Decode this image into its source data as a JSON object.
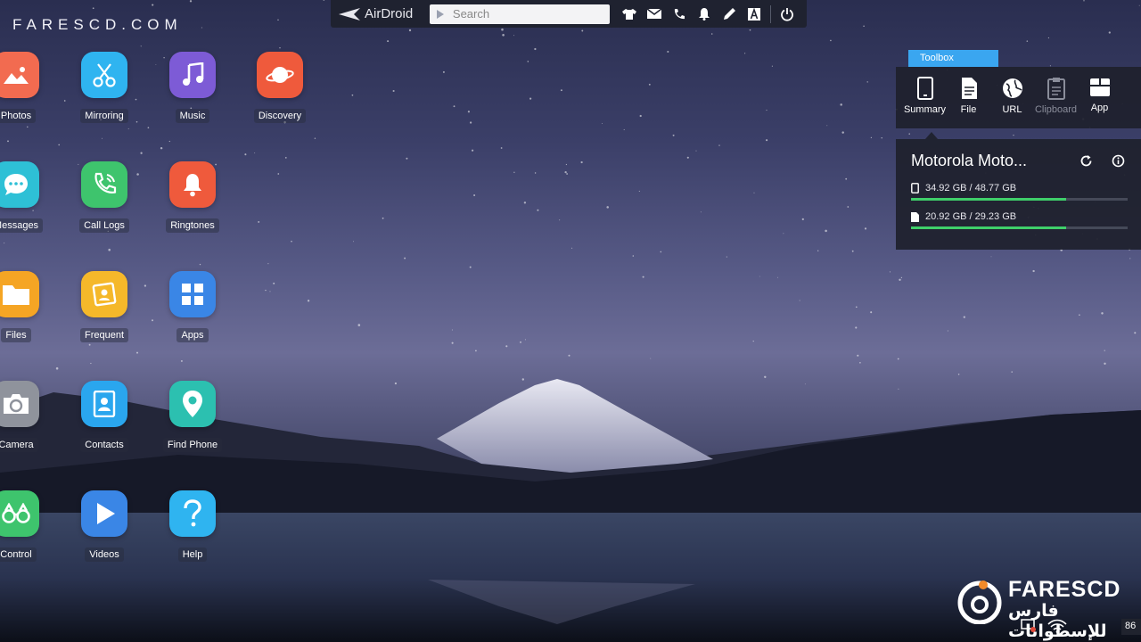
{
  "watermark_top": "FARESCD.COM",
  "topbar": {
    "brand": "AirDroid",
    "search_placeholder": "Search",
    "icons": [
      "tshirt-icon",
      "mail-icon",
      "phone-icon",
      "bell-icon",
      "pen-icon",
      "font-icon",
      "power-icon"
    ]
  },
  "apps": [
    {
      "label": "Photos",
      "color": "#f26b50",
      "icon": "photos-icon"
    },
    {
      "label": "Mirroring",
      "color": "#2fb4f0",
      "icon": "scissors-icon"
    },
    {
      "label": "Music",
      "color": "#7d5bd6",
      "icon": "music-note-icon"
    },
    {
      "label": "Discovery",
      "color": "#ef5a3c",
      "icon": "planet-icon"
    },
    {
      "label": "Messages",
      "color": "#2ec0d6",
      "icon": "chat-bubble-icon"
    },
    {
      "label": "Call Logs",
      "color": "#3ec46d",
      "icon": "phone-icon"
    },
    {
      "label": "Ringtones",
      "color": "#ef5a3c",
      "icon": "bell-icon"
    },
    {
      "label": "Files",
      "color": "#f5a524",
      "icon": "folder-icon"
    },
    {
      "label": "Frequent",
      "color": "#f5b82a",
      "icon": "contact-card-icon"
    },
    {
      "label": "Apps",
      "color": "#3a86e6",
      "icon": "grid-icon"
    },
    {
      "label": "Camera",
      "color": "#8f939c",
      "icon": "camera-icon"
    },
    {
      "label": "Contacts",
      "color": "#2aa6ee",
      "icon": "address-book-icon"
    },
    {
      "label": "Find Phone",
      "color": "#2cc0b0",
      "icon": "location-pin-icon"
    },
    {
      "label": "Control",
      "color": "#3ec46d",
      "icon": "binoculars-icon"
    },
    {
      "label": "Videos",
      "color": "#3a86e6",
      "icon": "play-icon"
    },
    {
      "label": "Help",
      "color": "#2fb4f0",
      "icon": "question-icon"
    }
  ],
  "toolbox": {
    "tab_label": "Toolbox",
    "tools": [
      {
        "label": "Summary",
        "icon": "phone-outline-icon",
        "disabled": false
      },
      {
        "label": "File",
        "icon": "document-icon",
        "disabled": false
      },
      {
        "label": "URL",
        "icon": "globe-icon",
        "disabled": false
      },
      {
        "label": "Clipboard",
        "icon": "clipboard-icon",
        "disabled": true
      },
      {
        "label": "App",
        "icon": "app-box-icon",
        "disabled": false
      }
    ]
  },
  "device": {
    "name": "Motorola Moto...",
    "storage": [
      {
        "label": "34.92 GB / 48.77 GB",
        "icon": "phone-storage-icon",
        "fraction": 0.716
      },
      {
        "label": "20.92 GB / 29.23 GB",
        "icon": "sd-card-icon",
        "fraction": 0.716
      }
    ]
  },
  "logo": {
    "name": "FARESCD",
    "arabic": "فارس للإسطوانات"
  },
  "tray": {
    "badge": "86"
  },
  "colors": {
    "accent": "#3aa6f0",
    "storage_fill": "#3fcf6a",
    "panel_bg": "#1e212c"
  }
}
